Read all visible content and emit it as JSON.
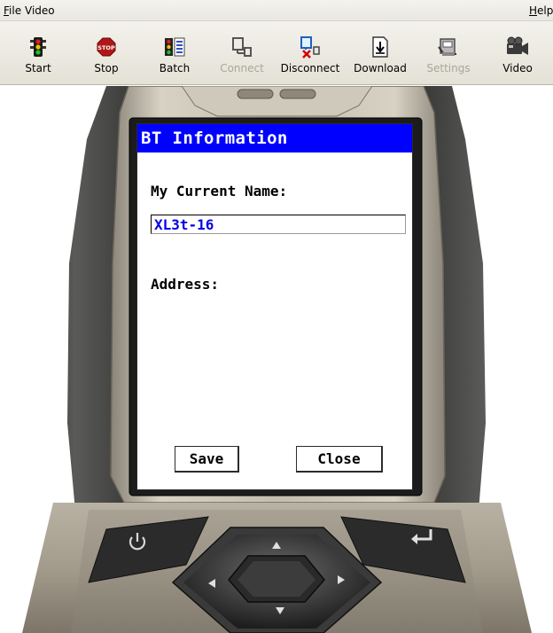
{
  "menu": {
    "file": {
      "mnemonic": "F",
      "rest": "ile"
    },
    "video": "Video",
    "help": {
      "mnemonic": "H",
      "rest": "elp"
    }
  },
  "toolbar": {
    "start": "Start",
    "stop": "Stop",
    "stop_icon_text": "STOP",
    "batch": "Batch",
    "connect": "Connect",
    "disconnect": "Disconnect",
    "download": "Download",
    "settings": "Settings",
    "video": "Video"
  },
  "toolbar_state": {
    "connect_enabled": false,
    "settings_enabled": false
  },
  "screen": {
    "title": "BT Information",
    "name_label": "My Current Name:",
    "name_value": "XL3t-16",
    "address_label": "Address:",
    "save_label": "Save",
    "close_label": "Close"
  },
  "colors": {
    "title_bar": "#0000ff",
    "input_text": "#0000e6",
    "disabled_text": "#a9a69c"
  },
  "icons": [
    "traffic-light-icon",
    "stop-sign-icon",
    "batch-icon",
    "connect-icon",
    "disconnect-icon",
    "download-icon",
    "settings-icon",
    "video-camera-icon",
    "power-icon",
    "enter-icon",
    "up-arrow-icon",
    "down-arrow-icon",
    "left-arrow-icon",
    "right-arrow-icon"
  ]
}
